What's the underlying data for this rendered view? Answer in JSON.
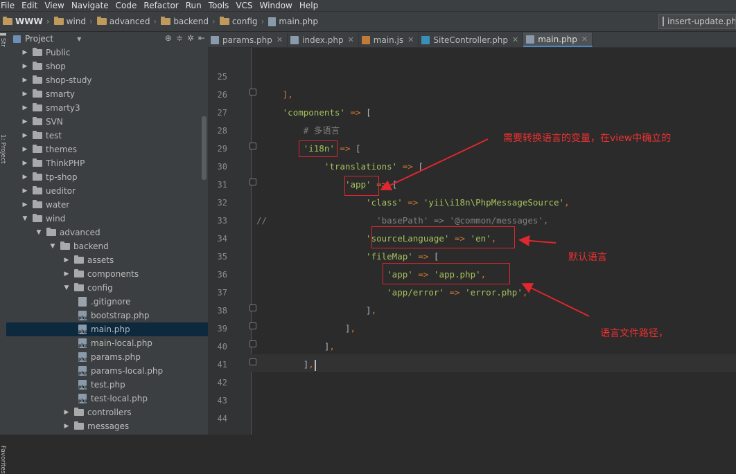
{
  "menu": [
    "File",
    "Edit",
    "View",
    "Navigate",
    "Code",
    "Refactor",
    "Run",
    "Tools",
    "VCS",
    "Window",
    "Help"
  ],
  "breadcrumb": [
    "WWW",
    "wind",
    "advanced",
    "backend",
    "config",
    "main.php"
  ],
  "run_config": "insert-update.ph",
  "panel": {
    "title": "Project"
  },
  "side_strip": {
    "top": "1: Project",
    "bottom": "Favorites"
  },
  "tree": [
    {
      "label": "Public",
      "type": "folder",
      "depth": 0,
      "arrow": "▶"
    },
    {
      "label": "shop",
      "type": "folder",
      "depth": 0,
      "arrow": "▶"
    },
    {
      "label": "shop-study",
      "type": "folder",
      "depth": 0,
      "arrow": "▶"
    },
    {
      "label": "smarty",
      "type": "folder",
      "depth": 0,
      "arrow": "▶"
    },
    {
      "label": "smarty3",
      "type": "folder",
      "depth": 0,
      "arrow": "▶"
    },
    {
      "label": "SVN",
      "type": "folder",
      "depth": 0,
      "arrow": "▶"
    },
    {
      "label": "test",
      "type": "folder",
      "depth": 0,
      "arrow": "▶"
    },
    {
      "label": "themes",
      "type": "folder",
      "depth": 0,
      "arrow": "▶"
    },
    {
      "label": "ThinkPHP",
      "type": "folder",
      "depth": 0,
      "arrow": "▶"
    },
    {
      "label": "tp-shop",
      "type": "folder",
      "depth": 0,
      "arrow": "▶"
    },
    {
      "label": "ueditor",
      "type": "folder",
      "depth": 0,
      "arrow": "▶"
    },
    {
      "label": "water",
      "type": "folder",
      "depth": 0,
      "arrow": "▶"
    },
    {
      "label": "wind",
      "type": "folder",
      "depth": 0,
      "arrow": "▼"
    },
    {
      "label": "advanced",
      "type": "folder",
      "depth": 1,
      "arrow": "▼"
    },
    {
      "label": "backend",
      "type": "folder",
      "depth": 2,
      "arrow": "▼"
    },
    {
      "label": "assets",
      "type": "folder",
      "depth": 3,
      "arrow": "▶"
    },
    {
      "label": "components",
      "type": "folder",
      "depth": 3,
      "arrow": "▶"
    },
    {
      "label": "config",
      "type": "folder",
      "depth": 3,
      "arrow": "▼"
    },
    {
      "label": ".gitignore",
      "type": "txt",
      "depth": 4,
      "arrow": ""
    },
    {
      "label": "bootstrap.php",
      "type": "php",
      "depth": 4,
      "arrow": ""
    },
    {
      "label": "main.php",
      "type": "php",
      "depth": 4,
      "arrow": "",
      "selected": true
    },
    {
      "label": "main-local.php",
      "type": "php",
      "depth": 4,
      "arrow": ""
    },
    {
      "label": "params.php",
      "type": "php",
      "depth": 4,
      "arrow": ""
    },
    {
      "label": "params-local.php",
      "type": "php",
      "depth": 4,
      "arrow": ""
    },
    {
      "label": "test.php",
      "type": "php",
      "depth": 4,
      "arrow": ""
    },
    {
      "label": "test-local.php",
      "type": "php",
      "depth": 4,
      "arrow": ""
    },
    {
      "label": "controllers",
      "type": "folder",
      "depth": 3,
      "arrow": "▶"
    },
    {
      "label": "messages",
      "type": "folder",
      "depth": 3,
      "arrow": "▶"
    }
  ],
  "tabs": [
    {
      "label": "params.php",
      "icon_color": "#8a9aaa",
      "active": false
    },
    {
      "label": "index.php",
      "icon_color": "#8a9aaa",
      "active": false
    },
    {
      "label": "main.js",
      "icon_color": "#c07a3a",
      "active": false
    },
    {
      "label": "SiteController.php",
      "icon_color": "#3a8fb8",
      "active": false
    },
    {
      "label": "main.php",
      "icon_color": "#8a9aaa",
      "active": true
    }
  ],
  "close_glyph": "✕",
  "line_numbers": [
    "25",
    "26",
    "27",
    "28",
    "29",
    "30",
    "31",
    "32",
    "33",
    "34",
    "35",
    "36",
    "37",
    "38",
    "39",
    "40",
    "41",
    "42",
    "43",
    "44"
  ],
  "annotations": {
    "top": "需要转换语言的变量，在view中确立的",
    "middle": "默认语言",
    "bottom": "语言文件路径，"
  },
  "colors": {
    "string": "#a5c25c",
    "operator": "#cc7832",
    "highlight_box": "#e0262e",
    "annotation": "#f03030",
    "selection": "#0d293e"
  }
}
